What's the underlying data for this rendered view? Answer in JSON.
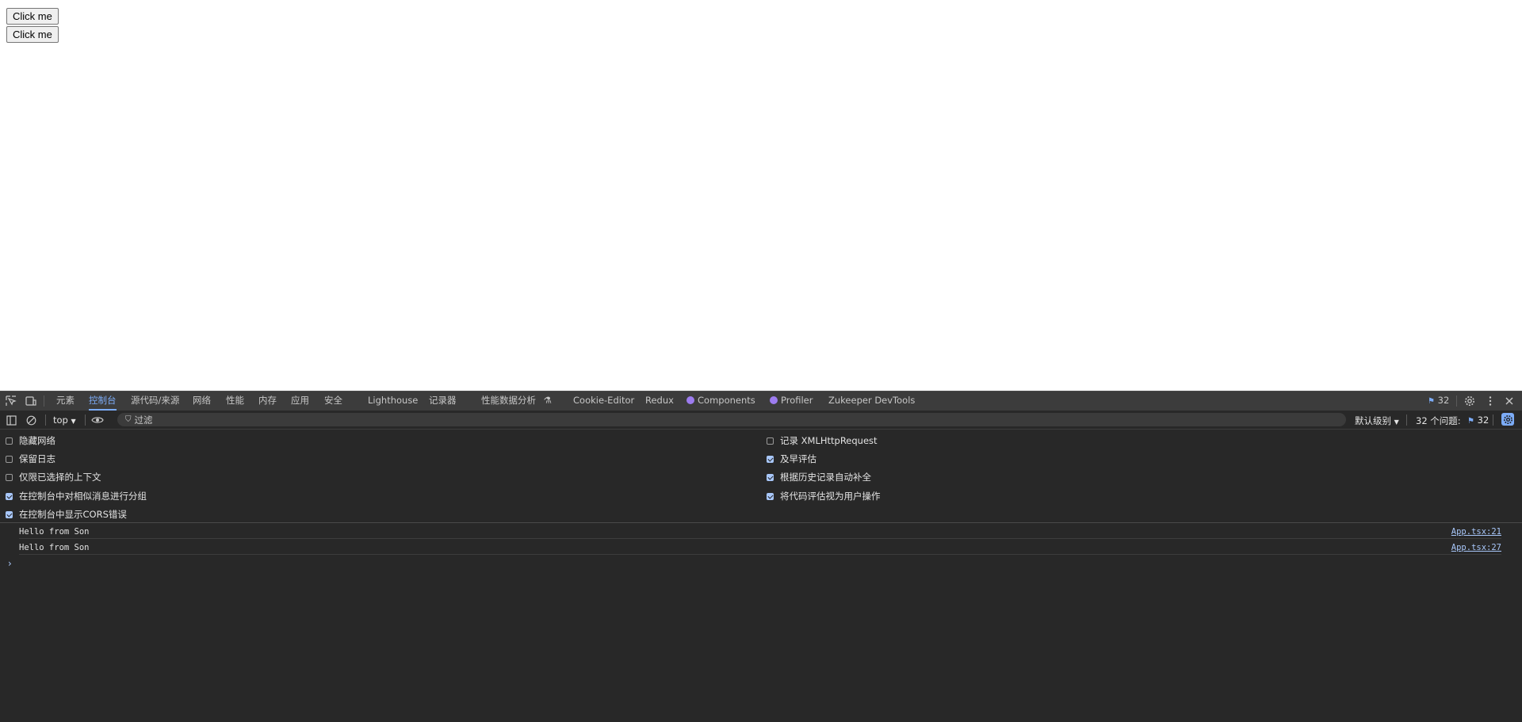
{
  "page": {
    "buttons": [
      "Click me",
      "Click me"
    ]
  },
  "devtools": {
    "tabs": {
      "elements": "元素",
      "console": "控制台",
      "sources": "源代码/来源",
      "network": "网络",
      "performance": "性能",
      "memory": "内存",
      "application": "应用",
      "security": "安全",
      "lighthouse": "Lighthouse",
      "recorder": "记录器",
      "perf_insights": "性能数据分析",
      "cookie_editor": "Cookie-Editor",
      "redux": "Redux",
      "components": "Components",
      "profiler": "Profiler",
      "zukeeper": "Zukeeper DevTools"
    },
    "issues_count": "32",
    "toolbar": {
      "context": "top",
      "filter_placeholder": "过滤",
      "levels": "默认级别",
      "issues_label": "32 个问题:",
      "issues_badge": "32"
    },
    "settings_left": [
      {
        "label": "隐藏网络",
        "checked": false
      },
      {
        "label": "保留日志",
        "checked": false
      },
      {
        "label": "仅限已选择的上下文",
        "checked": false
      },
      {
        "label": "在控制台中对相似消息进行分组",
        "checked": true
      },
      {
        "label": "在控制台中显示CORS错误",
        "checked": true
      }
    ],
    "settings_right": [
      {
        "label": "记录 XMLHttpRequest",
        "checked": false
      },
      {
        "label": "及早评估",
        "checked": true
      },
      {
        "label": "根据历史记录自动补全",
        "checked": true
      },
      {
        "label": "将代码评估视为用户操作",
        "checked": true
      }
    ],
    "messages": [
      {
        "text": "Hello from Son",
        "source": "App.tsx:21"
      },
      {
        "text": "Hello from Son",
        "source": "App.tsx:27"
      }
    ],
    "prompt": "›"
  },
  "colors": {
    "accent": "#7cacf8",
    "devtools_bg": "#282828",
    "tabbar_bg": "#3c3c3c"
  }
}
